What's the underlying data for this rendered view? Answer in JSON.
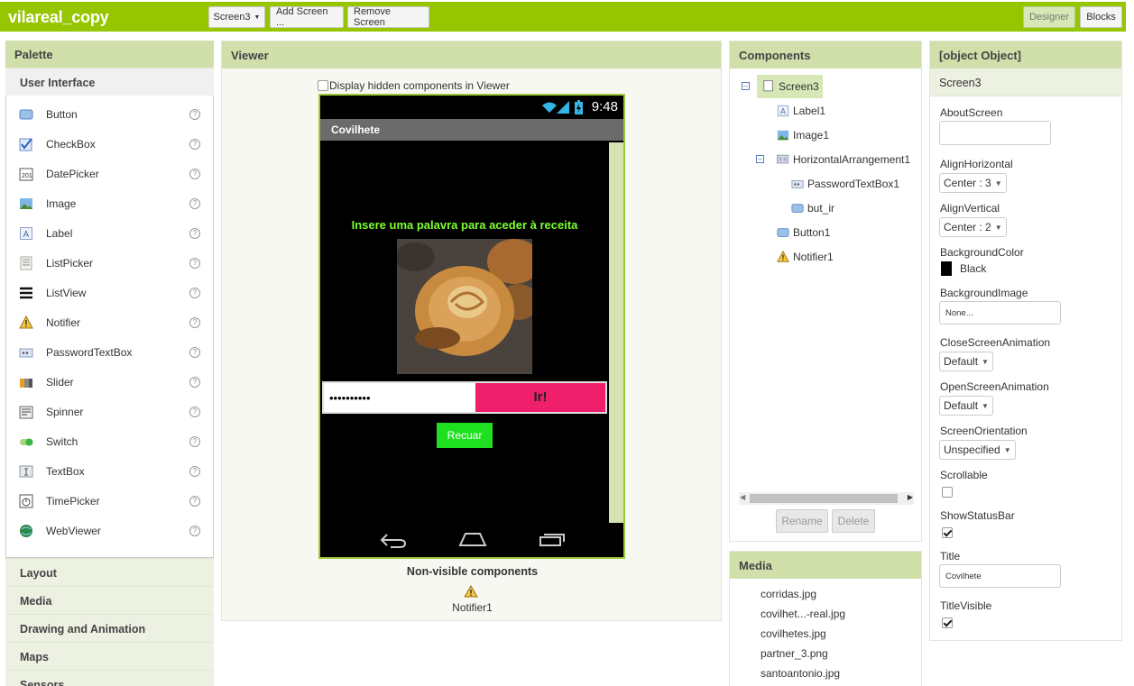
{
  "app": {
    "title": "vilareal_copy"
  },
  "toolbar": {
    "screen_select": "Screen3",
    "add_screen": "Add Screen ...",
    "remove_screen": "Remove Screen",
    "designer": "Designer",
    "blocks": "Blocks"
  },
  "palette": {
    "title": "Palette",
    "open_category": "User Interface",
    "items": [
      {
        "label": "Button",
        "icon": "button-icon"
      },
      {
        "label": "CheckBox",
        "icon": "checkbox-icon"
      },
      {
        "label": "DatePicker",
        "icon": "datepicker-icon"
      },
      {
        "label": "Image",
        "icon": "image-icon"
      },
      {
        "label": "Label",
        "icon": "label-icon"
      },
      {
        "label": "ListPicker",
        "icon": "listpicker-icon"
      },
      {
        "label": "ListView",
        "icon": "listview-icon"
      },
      {
        "label": "Notifier",
        "icon": "notifier-icon"
      },
      {
        "label": "PasswordTextBox",
        "icon": "passwordtextbox-icon"
      },
      {
        "label": "Slider",
        "icon": "slider-icon"
      },
      {
        "label": "Spinner",
        "icon": "spinner-icon"
      },
      {
        "label": "Switch",
        "icon": "switch-icon"
      },
      {
        "label": "TextBox",
        "icon": "textbox-icon"
      },
      {
        "label": "TimePicker",
        "icon": "timepicker-icon"
      },
      {
        "label": "WebViewer",
        "icon": "webviewer-icon"
      }
    ],
    "help_glyph": "?",
    "categories": [
      "Layout",
      "Media",
      "Drawing and Animation",
      "Maps",
      "Sensors"
    ]
  },
  "viewer": {
    "title": "Viewer",
    "hidden_checkbox_label": "Display hidden components in Viewer",
    "phone": {
      "clock": "9:48",
      "title_bar": "Covilhete",
      "prompt": "Insere uma palavra para aceder à receita",
      "password_value": "••••••••••",
      "go_button": "Ir!",
      "back_button": "Recuar"
    },
    "nonvisible_title": "Non-visible components",
    "nonvisible_item": "Notifier1"
  },
  "components": {
    "title": "Components",
    "tree": [
      {
        "label": "Screen3",
        "icon": "screen-icon"
      },
      {
        "label": "Label1",
        "icon": "label-icon"
      },
      {
        "label": "Image1",
        "icon": "image-icon"
      },
      {
        "label": "HorizontalArrangement1",
        "icon": "horizontal-arrangement-icon"
      },
      {
        "label": "PasswordTextBox1",
        "icon": "passwordtextbox-icon"
      },
      {
        "label": "but_ir",
        "icon": "button-icon"
      },
      {
        "label": "Button1",
        "icon": "button-icon"
      },
      {
        "label": "Notifier1",
        "icon": "notifier-icon"
      }
    ],
    "rename": "Rename",
    "delete": "Delete"
  },
  "media": {
    "title": "Media",
    "files": [
      "corridas.jpg",
      "covilhet...-real.jpg",
      "covilhetes.jpg",
      "partner_3.png",
      "santoantonio.jpg"
    ]
  },
  "properties": {
    "title": {
      "label": "Title",
      "value": "Covilhete"
    },
    "component": "Screen3",
    "about_screen": {
      "label": "AboutScreen",
      "value": ""
    },
    "align_horizontal": {
      "label": "AlignHorizontal",
      "value": "Center : 3"
    },
    "align_vertical": {
      "label": "AlignVertical",
      "value": "Center : 2"
    },
    "background_color": {
      "label": "BackgroundColor",
      "value": "Black",
      "swatch": "#000000"
    },
    "background_image": {
      "label": "BackgroundImage",
      "value": "None..."
    },
    "close_screen_animation": {
      "label": "CloseScreenAnimation",
      "value": "Default"
    },
    "open_screen_animation": {
      "label": "OpenScreenAnimation",
      "value": "Default"
    },
    "screen_orientation": {
      "label": "ScreenOrientation",
      "value": "Unspecified"
    },
    "scrollable": {
      "label": "Scrollable",
      "checked": false
    },
    "show_status_bar": {
      "label": "ShowStatusBar",
      "checked": true
    },
    "title_visible": {
      "label": "TitleVisible",
      "checked": true
    }
  },
  "colors": {
    "topbar": "#95c600",
    "panel_header": "#d1dfab",
    "prompt_text": "#7cff2f",
    "go_button": "#f01f6b",
    "back_button": "#1fe01f"
  }
}
